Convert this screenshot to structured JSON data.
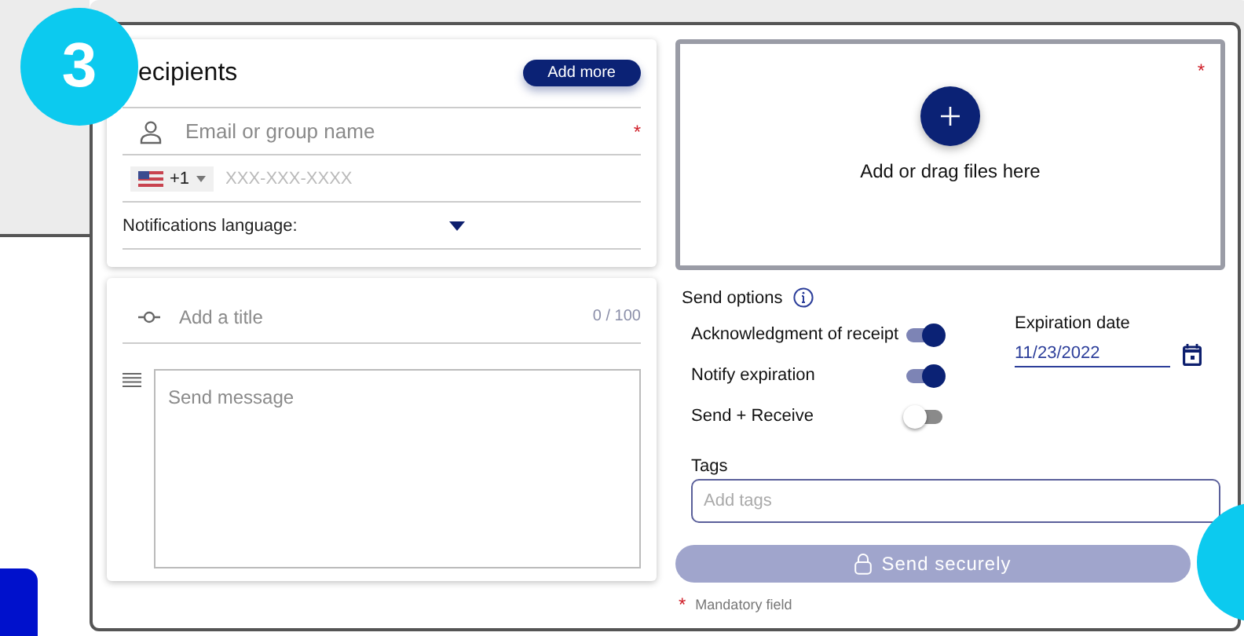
{
  "step_badge": "3",
  "recipients": {
    "title": "ecipients",
    "add_button": "Add more",
    "email_placeholder": "Email or group name",
    "required_mark": "*",
    "phone_code": "+1",
    "phone_placeholder": "XXX-XXX-XXXX",
    "language_label": "Notifications language:"
  },
  "message": {
    "title_placeholder": "Add a title",
    "counter": "0 / 100",
    "body_placeholder": "Send message"
  },
  "dropzone": {
    "text": "Add or drag files here",
    "required_mark": "*"
  },
  "send_options": {
    "label": "Send options",
    "toggles": [
      {
        "label": "Acknowledgment of receipt",
        "on": true
      },
      {
        "label": "Notify expiration",
        "on": true
      },
      {
        "label": "Send + Receive",
        "on": false
      }
    ],
    "expiration": {
      "label": "Expiration date",
      "value": "11/23/2022"
    }
  },
  "tags": {
    "label": "Tags",
    "placeholder": "Add tags"
  },
  "send_button": {
    "label": "Send securely",
    "disabled": true
  },
  "footnote": {
    "mark": "*",
    "text": "Mandatory field"
  }
}
